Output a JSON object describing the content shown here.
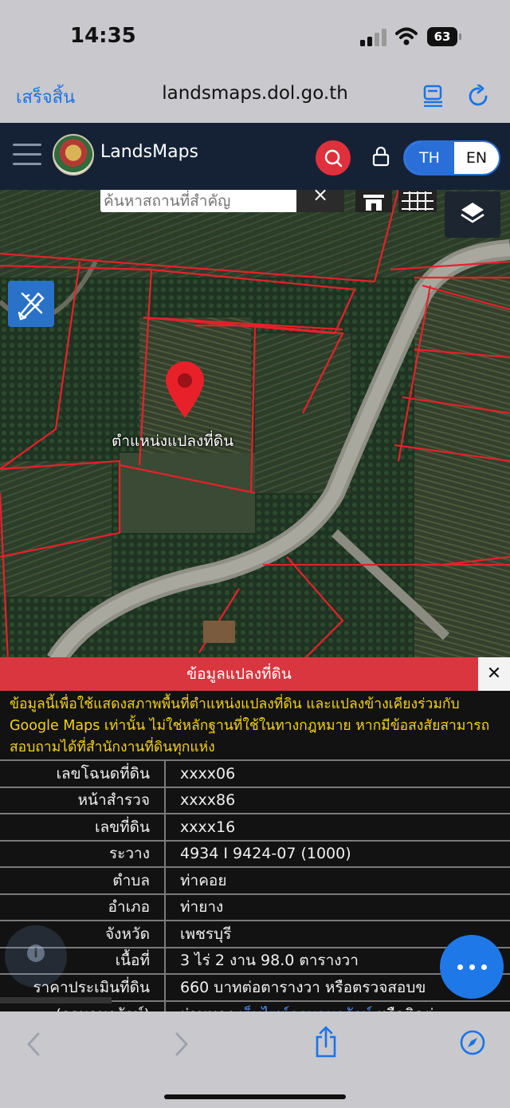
{
  "status_bar": {
    "time": "14:35",
    "battery": "63",
    "icons": [
      "cellular-signal-icon",
      "wifi-icon",
      "battery-icon"
    ]
  },
  "browser": {
    "done_label": "เสร็จสิ้น",
    "url": "landsmaps.dol.go.th",
    "icons": [
      "reader-icon",
      "reload-icon",
      "back-icon",
      "forward-icon",
      "share-icon",
      "compass-icon"
    ]
  },
  "header": {
    "brand": "LandsMaps",
    "lang_th": "TH",
    "lang_en": "EN",
    "icons": [
      "menu-icon",
      "logo",
      "search-icon",
      "lock-icon"
    ]
  },
  "map": {
    "search_placeholder": "ค้นหาสถานที่สำคัญ",
    "clear_label": "×",
    "marker_label": "ตำแหน่งแปลงที่ดิน",
    "colors": {
      "parcel_line": "#e8202a",
      "marker": "#e8202a"
    },
    "icons": [
      "house-icon",
      "grid-icon",
      "layers-icon",
      "draw-tool-icon",
      "location-pin-icon"
    ]
  },
  "panel": {
    "title": "ข้อมูลแปลงที่ดิน",
    "close_label": "✕",
    "notice": "ข้อมูลนี้เพื่อใช้แสดงสภาพพื้นที่ตำแหน่งแปลงที่ดิน และแปลงข้างเคียงร่วมกับ Google Maps เท่านั้น ไม่ใช่หลักฐานที่ใช้ในทางกฎหมาย หากมีข้อสงสัยสามารถสอบถามได้ที่สำนักงานที่ดินทุกแห่ง",
    "rows": [
      {
        "label": "เลขโฉนดที่ดิน",
        "value": "xxxx06"
      },
      {
        "label": "หน้าสำรวจ",
        "value": "xxxx86"
      },
      {
        "label": "เลขที่ดิน",
        "value": "xxxx16"
      },
      {
        "label": "ระวาง",
        "value": "4934 I 9424-07 (1000)"
      },
      {
        "label": "ตำบล",
        "value": "ท่าคอย"
      },
      {
        "label": "อำเภอ",
        "value": "ท่ายาง"
      },
      {
        "label": "จังหวัด",
        "value": "เพชรบุรี"
      },
      {
        "label": "เนื้อที่",
        "value": "3 ไร่ 2 งาน 98.0 ตารางวา"
      },
      {
        "label": "ราคาประเมินที่ดิน",
        "value": "660 บาทต่อตารางวา หรือตรวจสอบข"
      },
      {
        "label": "(กรมธนารักษ์)",
        "value_prefix": "ผ่านทาง ",
        "value_link": "เว็บไซต์กรมธนารักษ์",
        "value_suffix": " หรือติดต่"
      }
    ],
    "colors": {
      "header_bg": "#d9363f",
      "notice_text": "#f5d215",
      "link": "#4c8df2"
    }
  },
  "fab": {
    "info_label": "i",
    "more_icon": "more-dots-icon"
  }
}
